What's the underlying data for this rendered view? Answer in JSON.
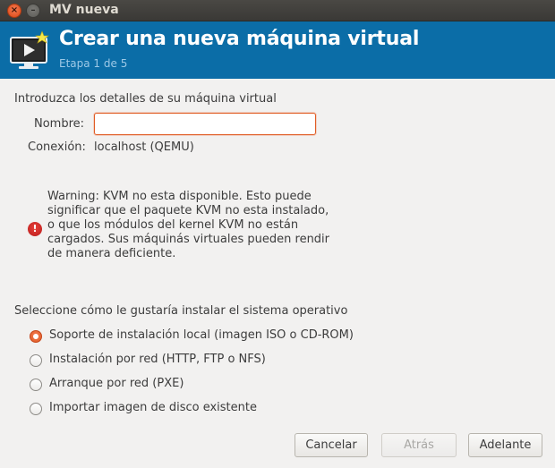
{
  "window": {
    "title": "MV nueva",
    "close_glyph": "×",
    "minimize_glyph": "–"
  },
  "header": {
    "title": "Crear una nueva máquina virtual",
    "step": "Etapa 1 de 5",
    "background_color": "#0b6da7",
    "icon": "new-vm-monitor-icon"
  },
  "details": {
    "heading": "Introduzca los detalles de su máquina virtual",
    "name_label": "Nombre:",
    "name_value": "",
    "connection_label": "Conexión:",
    "connection_value": "localhost (QEMU)"
  },
  "warning": {
    "icon": "error-icon",
    "icon_glyph": "!",
    "text": "Warning: KVM no esta disponible. Esto puede significar que el paquete KVM no esta instalado, o que los módulos del kernel KVM no están cargados. Sus máquinás virtuales pueden rendir de manera deficiente."
  },
  "install": {
    "heading": "Seleccione cómo le gustaría instalar el sistema operativo",
    "options": [
      {
        "label": "Soporte de instalación local (imagen ISO o CD-ROM)",
        "selected": true
      },
      {
        "label": "Instalación por red (HTTP, FTP o NFS)",
        "selected": false
      },
      {
        "label": "Arranque por red (PXE)",
        "selected": false
      },
      {
        "label": "Importar imagen de disco existente",
        "selected": false
      }
    ]
  },
  "buttons": {
    "cancel": "Cancelar",
    "back": "Atrás",
    "forward": "Adelante"
  },
  "colors": {
    "accent": "#e05c24",
    "error": "#c62828"
  }
}
